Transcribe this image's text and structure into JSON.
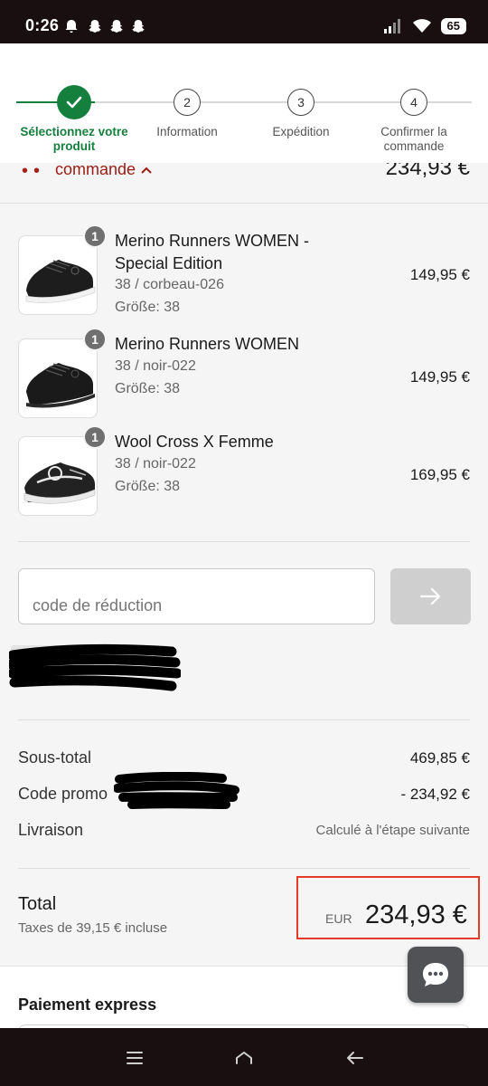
{
  "status_bar": {
    "time": "0:26",
    "battery": "65"
  },
  "steps": [
    {
      "label": "Sélectionnez votre produit",
      "number": "1",
      "state": "done"
    },
    {
      "label": "Information",
      "number": "2",
      "state": "todo"
    },
    {
      "label": "Expédition",
      "number": "3",
      "state": "todo"
    },
    {
      "label": "Confirmer la commande",
      "number": "4",
      "state": "todo"
    }
  ],
  "summary": {
    "toggle_label": "commande",
    "total": "234,93 €"
  },
  "products": [
    {
      "name": "Merino Runners WOMEN - Special Edition",
      "variant": "38 / corbeau-026",
      "size": "Größe: 38",
      "price": "149,95 €",
      "quantity": "1"
    },
    {
      "name": "Merino Runners WOMEN",
      "variant": "38 / noir-022",
      "size": "Größe: 38",
      "price": "149,95 €",
      "quantity": "1"
    },
    {
      "name": "Wool Cross X Femme",
      "variant": "38 / noir-022",
      "size": "Größe: 38",
      "price": "169,95 €",
      "quantity": "1"
    }
  ],
  "discount": {
    "placeholder": "code de réduction"
  },
  "totals": {
    "subtotal_label": "Sous-total",
    "subtotal_value": "469,85 €",
    "promo_label": "Code promo",
    "promo_value": "- 234,92 €",
    "shipping_label": "Livraison",
    "shipping_value": "Calculé à l'étape suivante",
    "total_label": "Total",
    "tax_note": "Taxes de 39,15 € incluse",
    "currency": "EUR",
    "total_value": "234,93 €"
  },
  "express": {
    "title": "Paiement express"
  },
  "colors": {
    "accent_green": "#15803d",
    "accent_red": "#9b1c14",
    "highlight_box": "#e53a26"
  }
}
